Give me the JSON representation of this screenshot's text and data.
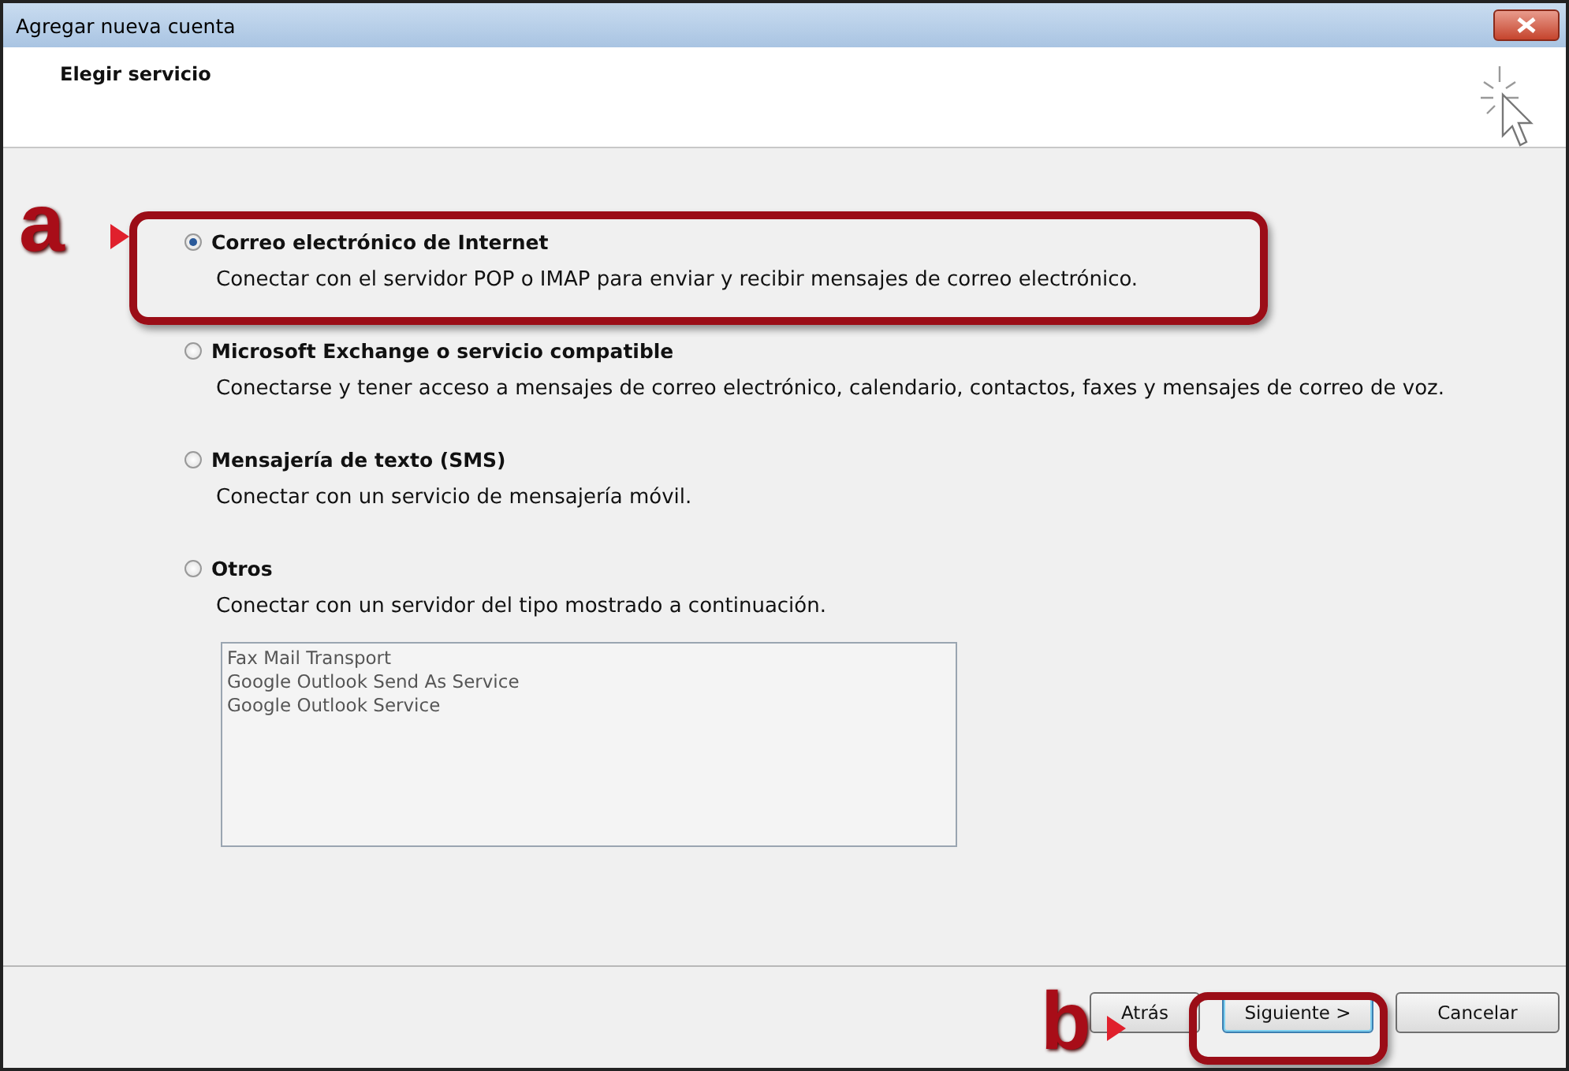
{
  "window": {
    "title": "Agregar nueva cuenta"
  },
  "header": {
    "title": "Elegir servicio"
  },
  "options": [
    {
      "label": "Correo electrónico de Internet",
      "description": "Conectar con el servidor POP o IMAP para enviar y recibir mensajes de correo electrónico.",
      "selected": true
    },
    {
      "label": "Microsoft Exchange o servicio compatible",
      "description": "Conectarse y tener acceso a mensajes de correo electrónico, calendario, contactos, faxes y mensajes de correo de voz.",
      "selected": false
    },
    {
      "label": "Mensajería de texto (SMS)",
      "description": "Conectar con un servicio de mensajería móvil.",
      "selected": false
    },
    {
      "label": "Otros",
      "description": "Conectar con un servidor del tipo mostrado a continuación.",
      "selected": false,
      "list": [
        "Fax Mail Transport",
        "Google Outlook Send As Service",
        "Google Outlook Service"
      ]
    }
  ],
  "buttons": [
    {
      "label": "Atrás",
      "kind": "back"
    },
    {
      "label": "Siguiente >",
      "kind": "default"
    },
    {
      "label": "Cancelar",
      "kind": "normal"
    }
  ],
  "annotations": [
    {
      "label": "a"
    },
    {
      "label": "b"
    }
  ]
}
